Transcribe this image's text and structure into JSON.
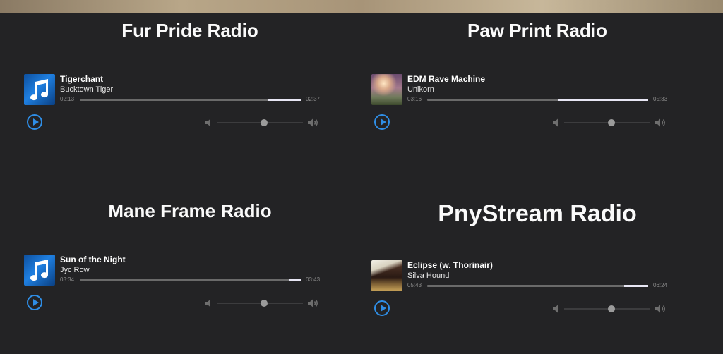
{
  "stations": [
    {
      "name": "Fur Pride Radio",
      "cover_icon": "music-note-icon",
      "track": {
        "title": "Tigerchant",
        "artist": "Bucktown Tiger"
      },
      "current_time": "02:13",
      "duration": "02:37",
      "progress": 0.85,
      "volume": 0.55
    },
    {
      "name": "Paw Print Radio",
      "cover_icon": "album-art",
      "track": {
        "title": "EDM Rave Machine",
        "artist": "Unikorn"
      },
      "current_time": "03:16",
      "duration": "05:33",
      "progress": 0.59,
      "volume": 0.55
    },
    {
      "name": "Mane Frame Radio",
      "cover_icon": "music-note-icon",
      "track": {
        "title": "Sun of the Night",
        "artist": "Jyc Row"
      },
      "current_time": "03:34",
      "duration": "03:43",
      "progress": 0.95,
      "volume": 0.55
    },
    {
      "name": "PnyStream Radio",
      "cover_icon": "album-art",
      "track": {
        "title": "Eclipse (w. Thorinair)",
        "artist": "Silva Hound"
      },
      "current_time": "05:43",
      "duration": "06:24",
      "progress": 0.89,
      "volume": 0.55
    }
  ],
  "colors": {
    "background": "#232325",
    "accent": "#2f8ee6",
    "progress_fill": "#e7e6f4",
    "progress_track": "#6a6a6a"
  }
}
